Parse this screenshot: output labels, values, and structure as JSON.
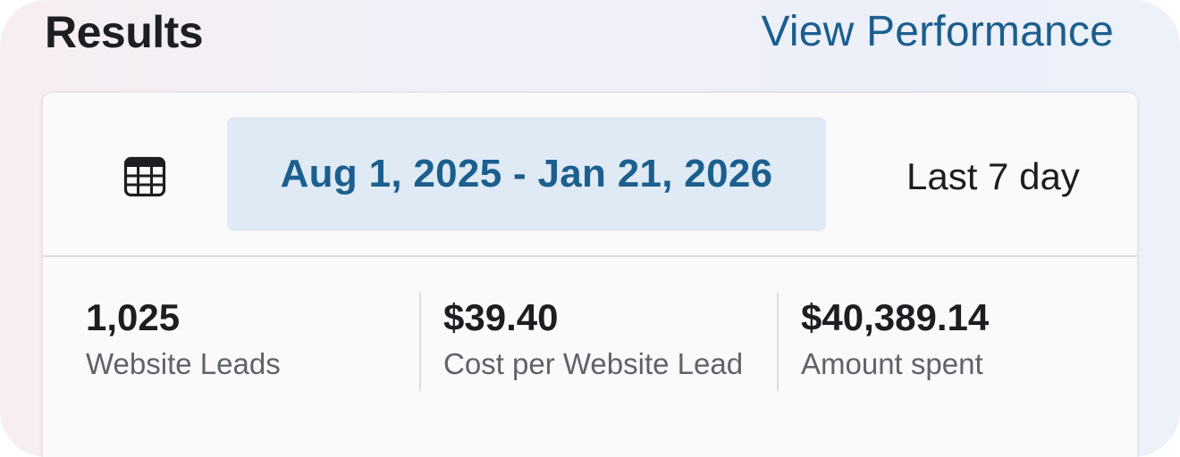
{
  "header": {
    "title": "Results",
    "view_performance_label": "View Performance"
  },
  "date_filter": {
    "calendar_icon": "calendar-icon",
    "selected_range": "Aug 1, 2025 - Jan 21, 2026",
    "preset_label": "Last 7 day"
  },
  "metrics": [
    {
      "value": "1,025",
      "label": "Website Leads"
    },
    {
      "value": "$39.40",
      "label": "Cost per Website Lead"
    },
    {
      "value": "$40,389.14",
      "label": "Amount spent"
    }
  ],
  "colors": {
    "accent": "#1b5f8e",
    "selected_pill_bg": "#dfeaf5",
    "text_primary": "#1c1e21",
    "text_secondary": "#5f6368"
  }
}
